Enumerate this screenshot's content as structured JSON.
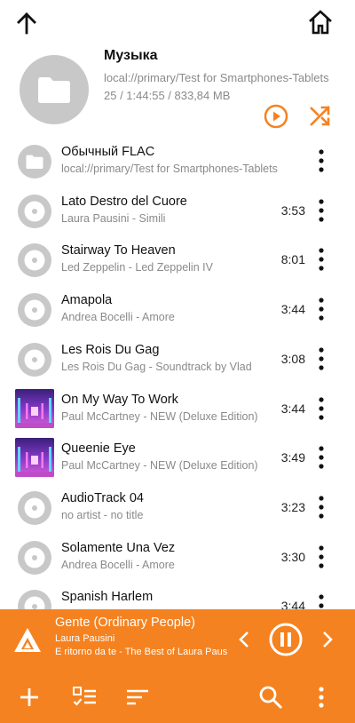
{
  "folder": {
    "title": "Музыка",
    "path": "local://primary/Test for Smartphones-Tablets",
    "stats": "25 / 1:44:55 / 833,84 MB"
  },
  "icons": {
    "back": "arrow-up-icon",
    "home": "home-icon",
    "folder": "folder-icon",
    "disc": "disc-icon",
    "album_art": "album-art-neon-corridor",
    "play_all": "play-circle-icon",
    "shuffle": "shuffle-icon",
    "more": "more-vertical-icon",
    "app_logo": "app-logo-icon",
    "prev": "chevron-left-icon",
    "pause": "pause-circle-icon",
    "next": "chevron-right-icon",
    "add": "plus-icon",
    "checklist": "checklist-icon",
    "sort": "sort-lines-icon",
    "search": "search-icon"
  },
  "colors": {
    "accent": "#f58220",
    "thumb_gray": "#c8c8c8",
    "secondary_text": "#8a8a8a"
  },
  "items": [
    {
      "type": "folder",
      "title": "Обычный FLAC",
      "subtitle": "local://primary/Test for Smartphones-Tablets",
      "duration": ""
    },
    {
      "type": "track",
      "title": "Lato Destro del Cuore",
      "subtitle": "Laura Pausini - Simili",
      "duration": "3:53"
    },
    {
      "type": "track",
      "title": "Stairway To Heaven",
      "subtitle": "Led Zeppelin - Led Zeppelin IV",
      "duration": "8:01"
    },
    {
      "type": "track",
      "title": "Amapola",
      "subtitle": "Andrea Bocelli - Amore",
      "duration": "3:44"
    },
    {
      "type": "track",
      "title": "Les Rois Du Gag",
      "subtitle": "Les Rois Du Gag - Soundtrack by Vlad",
      "duration": "3:08"
    },
    {
      "type": "track-art",
      "title": "On My Way To Work",
      "subtitle": "Paul McCartney - NEW (Deluxe Edition)",
      "duration": "3:44"
    },
    {
      "type": "track-art",
      "title": "Queenie Eye",
      "subtitle": "Paul McCartney - NEW (Deluxe Edition)",
      "duration": "3:49"
    },
    {
      "type": "track",
      "title": "AudioTrack 04",
      "subtitle": "no artist - no title",
      "duration": "3:23"
    },
    {
      "type": "track",
      "title": "Solamente Una Vez",
      "subtitle": "Andrea Bocelli - Amore",
      "duration": "3:30"
    },
    {
      "type": "track",
      "title": "Spanish Harlem",
      "subtitle": "",
      "duration": "3:44"
    }
  ],
  "now_playing": {
    "title": "Gente (Ordinary People)",
    "artist": "Laura Pausini",
    "album": "E ritorno da te - The Best of Laura Pausini"
  }
}
